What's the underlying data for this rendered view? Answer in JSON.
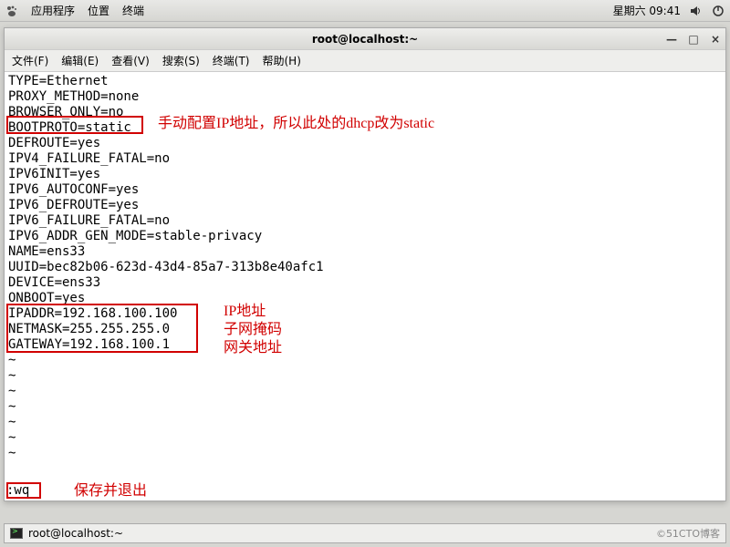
{
  "topbar": {
    "apps": "应用程序",
    "places": "位置",
    "terminal": "终端",
    "date": "星期六 09:41"
  },
  "window": {
    "title": "root@localhost:~"
  },
  "menus": {
    "file": "文件(F)",
    "edit": "编辑(E)",
    "view": "查看(V)",
    "search": "搜索(S)",
    "terminal": "终端(T)",
    "help": "帮助(H)"
  },
  "config": {
    "l0": "TYPE=Ethernet",
    "l1": "PROXY_METHOD=none",
    "l2": "BROWSER_ONLY=no",
    "l3": "BOOTPROTO=static",
    "l4": "DEFROUTE=yes",
    "l5": "IPV4_FAILURE_FATAL=no",
    "l6": "IPV6INIT=yes",
    "l7": "IPV6_AUTOCONF=yes",
    "l8": "IPV6_DEFROUTE=yes",
    "l9": "IPV6_FAILURE_FATAL=no",
    "l10": "IPV6_ADDR_GEN_MODE=stable-privacy",
    "l11": "NAME=ens33",
    "l12": "UUID=bec82b06-623d-43d4-85a7-313b8e40afc1",
    "l13": "DEVICE=ens33",
    "l14": "ONBOOT=yes",
    "l15": "IPADDR=192.168.100.100",
    "l16": "NETMASK=255.255.255.0",
    "l17": "GATEWAY=192.168.100.1"
  },
  "annotations": {
    "bootproto": "手动配置IP地址，所以此处的dhcp改为static",
    "ipaddr": "IP地址",
    "netmask": "子网掩码",
    "gateway": "网关地址",
    "save": "保存并退出"
  },
  "vim": {
    "cmd": ":wq"
  },
  "taskbar": {
    "item": "root@localhost:~",
    "watermark": "©51CTO博客"
  },
  "tilde": "~"
}
